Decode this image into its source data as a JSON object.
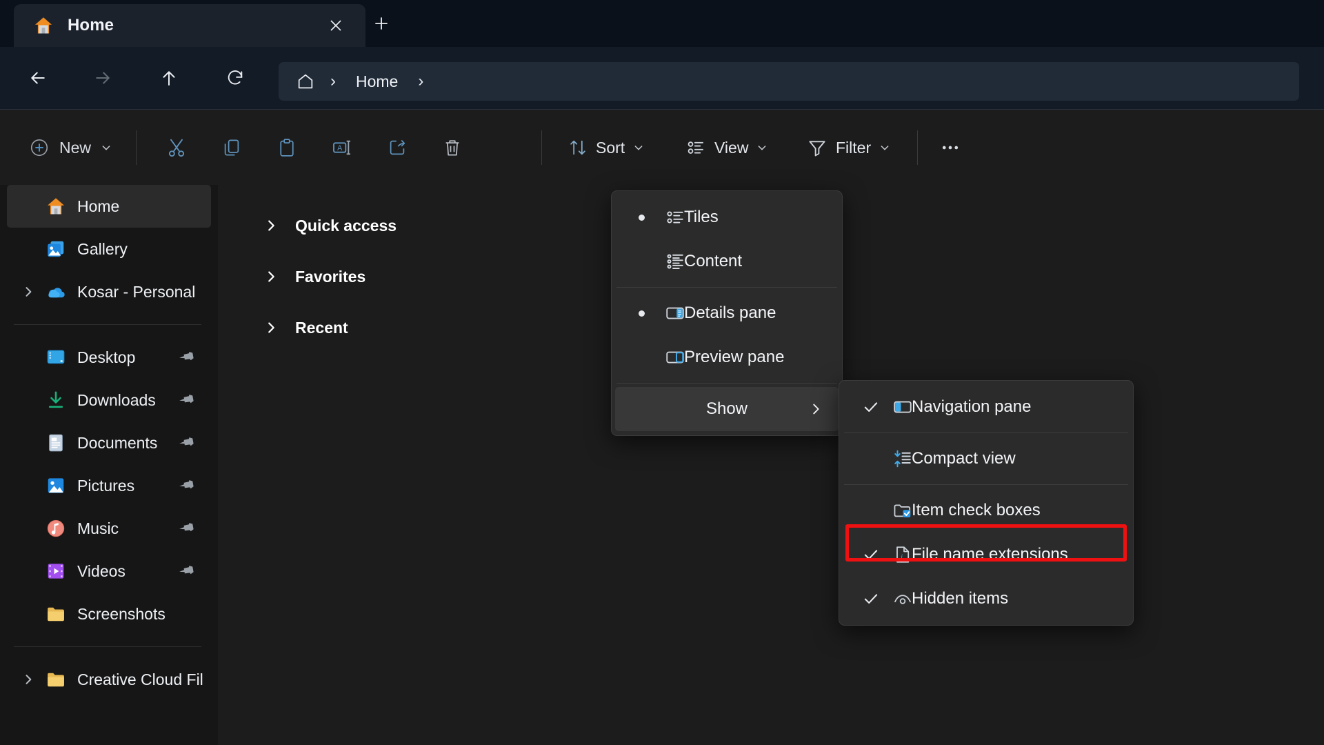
{
  "window": {
    "tab": {
      "title": "Home",
      "icon": "home-icon",
      "close_label": "✕"
    },
    "new_tab_label": "+"
  },
  "nav": {
    "back": "←",
    "forward": "→",
    "up": "↑",
    "refresh": "↻",
    "breadcrumb": {
      "home_icon": "home-outline-icon",
      "sep1": "›",
      "path": "Home",
      "sep2": "›"
    }
  },
  "toolbar": {
    "new_label": "New",
    "new_chevron": "⌄",
    "icons": [
      {
        "name": "cut-icon",
        "tooltip": "Cut"
      },
      {
        "name": "copy-icon",
        "tooltip": "Copy"
      },
      {
        "name": "paste-icon",
        "tooltip": "Paste"
      },
      {
        "name": "rename-icon",
        "tooltip": "Rename"
      },
      {
        "name": "share-icon",
        "tooltip": "Share"
      },
      {
        "name": "delete-icon",
        "tooltip": "Delete"
      }
    ],
    "sort_label": "Sort",
    "view_label": "View",
    "filter_label": "Filter",
    "overflow_label": "•••"
  },
  "sidebar": {
    "top": [
      {
        "label": "Home",
        "icon": "home-icon",
        "selected": true,
        "pinned": false,
        "expander": false
      },
      {
        "label": "Gallery",
        "icon": "gallery-icon",
        "selected": false,
        "pinned": false,
        "expander": false
      },
      {
        "label": "Kosar - Personal",
        "icon": "onedrive-icon",
        "selected": false,
        "pinned": false,
        "expander": true
      }
    ],
    "pinned": [
      {
        "label": "Desktop",
        "icon": "desktop-icon",
        "pinned": true
      },
      {
        "label": "Downloads",
        "icon": "downloads-icon",
        "pinned": true
      },
      {
        "label": "Documents",
        "icon": "documents-icon",
        "pinned": true
      },
      {
        "label": "Pictures",
        "icon": "pictures-icon",
        "pinned": true
      },
      {
        "label": "Music",
        "icon": "music-icon",
        "pinned": true
      },
      {
        "label": "Videos",
        "icon": "videos-icon",
        "pinned": true
      },
      {
        "label": "Screenshots",
        "icon": "folder-icon",
        "pinned": false
      }
    ],
    "bottom": [
      {
        "label": "Creative Cloud Fil",
        "icon": "folder-icon",
        "expander": true
      }
    ]
  },
  "main": {
    "groups": [
      {
        "label": "Quick access",
        "expanded": false
      },
      {
        "label": "Favorites",
        "expanded": false
      },
      {
        "label": "Recent",
        "expanded": false
      }
    ]
  },
  "view_menu": {
    "items": [
      {
        "label": "Tiles",
        "icon": "tiles-icon",
        "bullet": true
      },
      {
        "label": "Content",
        "icon": "content-icon",
        "bullet": false
      },
      {
        "label": "Details pane",
        "icon": "details-pane-icon",
        "bullet": true
      },
      {
        "label": "Preview pane",
        "icon": "preview-pane-icon",
        "bullet": false
      }
    ],
    "show_label": "Show",
    "show_chevron": "›",
    "show_highlighted": true
  },
  "show_menu": {
    "items": [
      {
        "label": "Navigation pane",
        "icon": "navigation-pane-icon",
        "checked": true,
        "highlighted": false
      },
      {
        "label": "Compact view",
        "icon": "compact-view-icon",
        "checked": false,
        "highlighted": false
      },
      {
        "label": "Item check boxes",
        "icon": "item-check-boxes-icon",
        "checked": false,
        "highlighted": false
      },
      {
        "label": "File name extensions",
        "icon": "file-name-extensions-icon",
        "checked": true,
        "highlighted": true
      },
      {
        "label": "Hidden items",
        "icon": "hidden-items-icon",
        "checked": true,
        "highlighted": false
      }
    ]
  },
  "colors": {
    "accent_blue": "#4cb3f0",
    "highlight_red": "#ef1111",
    "menu_bg": "#2b2b2b",
    "sidebar_bg": "#161616",
    "content_bg": "#1c1c1c",
    "titlebar_bg": "#0b111a"
  }
}
